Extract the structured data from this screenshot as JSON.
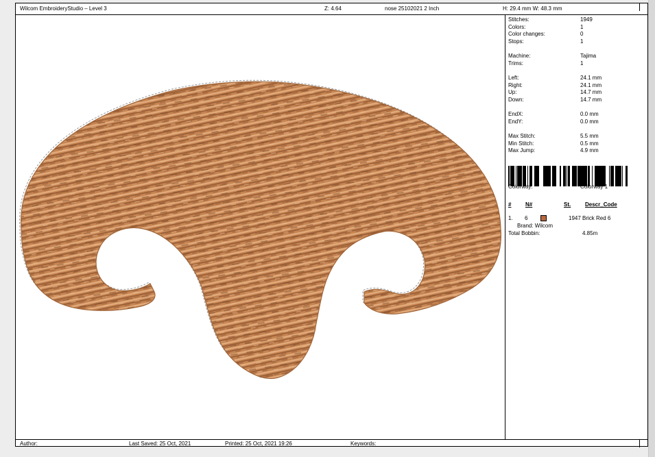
{
  "header": {
    "app_title": "Wilcom EmbroideryStudio – Level 3",
    "zoom": "Z: 4.64",
    "file": "nose 25102021 2  Inch",
    "dims": "H: 29.4 mm   W: 48.3 mm"
  },
  "stats": {
    "stitches": {
      "label": "Stitches:",
      "value": "1949"
    },
    "colors": {
      "label": "Colors:",
      "value": "1"
    },
    "color_changes": {
      "label": "Color changes:",
      "value": "0"
    },
    "stops": {
      "label": "Stops:",
      "value": "1"
    },
    "machine": {
      "label": "Machine:",
      "value": "Tajima"
    },
    "trims": {
      "label": "Trims:",
      "value": "1"
    },
    "left": {
      "label": "Left:",
      "value": "24.1 mm"
    },
    "right": {
      "label": "Right:",
      "value": "24.1 mm"
    },
    "up": {
      "label": "Up:",
      "value": "14.7 mm"
    },
    "down": {
      "label": "Down:",
      "value": "14.7 mm"
    },
    "endx": {
      "label": "EndX:",
      "value": "0.0 mm"
    },
    "endy": {
      "label": "EndY:",
      "value": "0.0 mm"
    },
    "max_stitch": {
      "label": "Max Stitch:",
      "value": "5.5 mm"
    },
    "min_stitch": {
      "label": "Min Stitch:",
      "value": "0.5 mm"
    },
    "max_jump": {
      "label": "Max Jump:",
      "value": "4.9 mm"
    }
  },
  "colorway": {
    "label": "Colorway:",
    "value": "Colorway 1"
  },
  "color_table": {
    "headers": {
      "num": "#",
      "n": "N#",
      "st": "St.",
      "descr": "Descr_Code"
    },
    "rows": [
      {
        "index": "1.",
        "n": "6",
        "swatch_color": "#b9683f",
        "st": "1947",
        "descr": "Brick Red 6",
        "brand": "Brand: Wilcom"
      }
    ],
    "total_bobbin_label": "Total Bobbin:",
    "total_bobbin_value": "4.85m"
  },
  "footer": {
    "author": "Author:",
    "last_saved": "Last Saved: 25 Oct, 2021",
    "printed": "Printed: 25 Oct, 2021 19:26",
    "keywords": "Keywords:"
  },
  "colors": {
    "thread_base": "#c68552",
    "thread_dark": "#8c5530",
    "thread_light": "#e6b183"
  }
}
